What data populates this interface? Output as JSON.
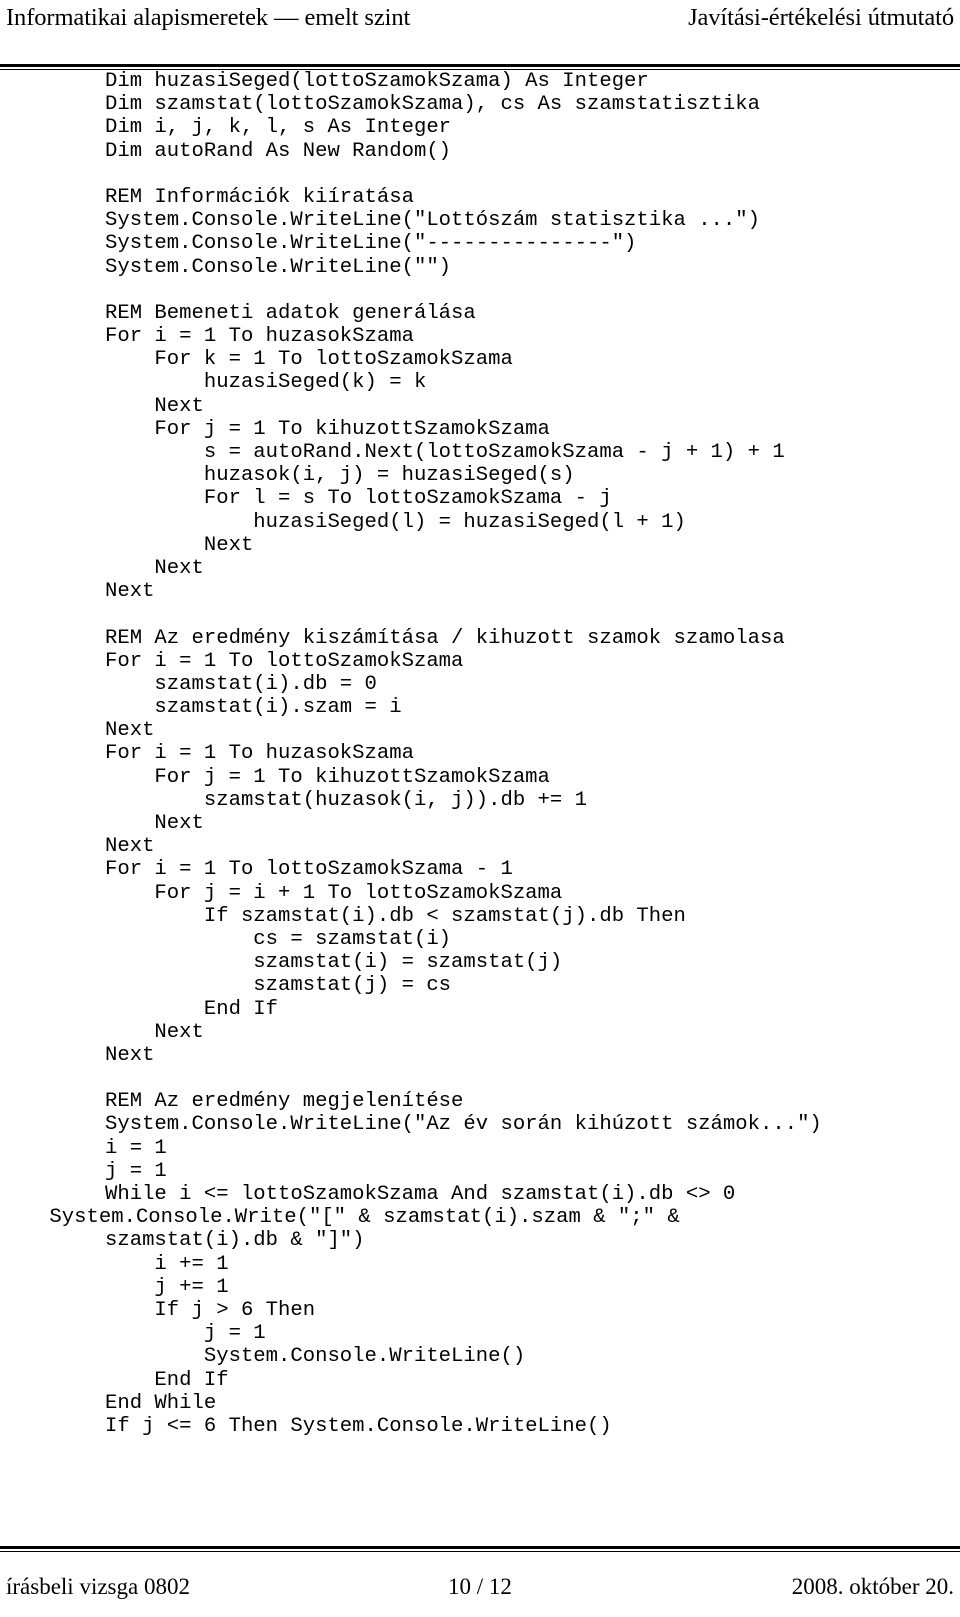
{
  "header": {
    "left": "Informatikai alapismeretek — emelt szint",
    "right": "Javítási-értékelési útmutató"
  },
  "code": {
    "language": "Visual Basic .NET",
    "lines": [
      "Dim huzasiSeged(lottoSzamokSzama) As Integer",
      "Dim szamstat(lottoSzamokSzama), cs As szamstatisztika",
      "Dim i, j, k, l, s As Integer",
      "Dim autoRand As New Random()",
      "",
      "REM Információk kiíratása",
      "System.Console.WriteLine(\"Lottószám statisztika ...\")",
      "System.Console.WriteLine(\"---------------\")",
      "System.Console.WriteLine(\"\")",
      "",
      "REM Bemeneti adatok generálása",
      "For i = 1 To huzasokSzama",
      "    For k = 1 To lottoSzamokSzama",
      "        huzasiSeged(k) = k",
      "    Next",
      "    For j = 1 To kihuzottSzamokSzama",
      "        s = autoRand.Next(lottoSzamokSzama - j + 1) + 1",
      "        huzasok(i, j) = huzasiSeged(s)",
      "        For l = s To lottoSzamokSzama - j",
      "            huzasiSeged(l) = huzasiSeged(l + 1)",
      "        Next",
      "    Next",
      "Next",
      "",
      "REM Az eredmény kiszámítása / kihuzott szamok szamolasa",
      "For i = 1 To lottoSzamokSzama",
      "    szamstat(i).db = 0",
      "    szamstat(i).szam = i",
      "Next",
      "For i = 1 To huzasokSzama",
      "    For j = 1 To kihuzottSzamokSzama",
      "        szamstat(huzasok(i, j)).db += 1",
      "    Next",
      "Next",
      "For i = 1 To lottoSzamokSzama - 1",
      "    For j = i + 1 To lottoSzamokSzama",
      "        If szamstat(i).db < szamstat(j).db Then",
      "            cs = szamstat(i)",
      "            szamstat(i) = szamstat(j)",
      "            szamstat(j) = cs",
      "        End If",
      "    Next",
      "Next",
      "",
      "REM Az eredmény megjelenítése",
      "System.Console.WriteLine(\"Az év során kihúzott számok...\")",
      "i = 1",
      "j = 1",
      "While i <= lottoSzamokSzama And szamstat(i).db <> 0",
      "    System.Console.Write(\"[\" & szamstat(i).szam & \";\" &",
      "szamstat(i).db & \"]\")",
      "    i += 1",
      "    j += 1",
      "    If j > 6 Then",
      "        j = 1",
      "        System.Console.WriteLine()",
      "    End If",
      "End While",
      "If j <= 6 Then System.Console.WriteLine()"
    ],
    "flush_line_indexes": [
      49
    ]
  },
  "footer": {
    "left": "írásbeli vizsga 0802",
    "center": "10 / 12",
    "right": "2008. október 20."
  }
}
